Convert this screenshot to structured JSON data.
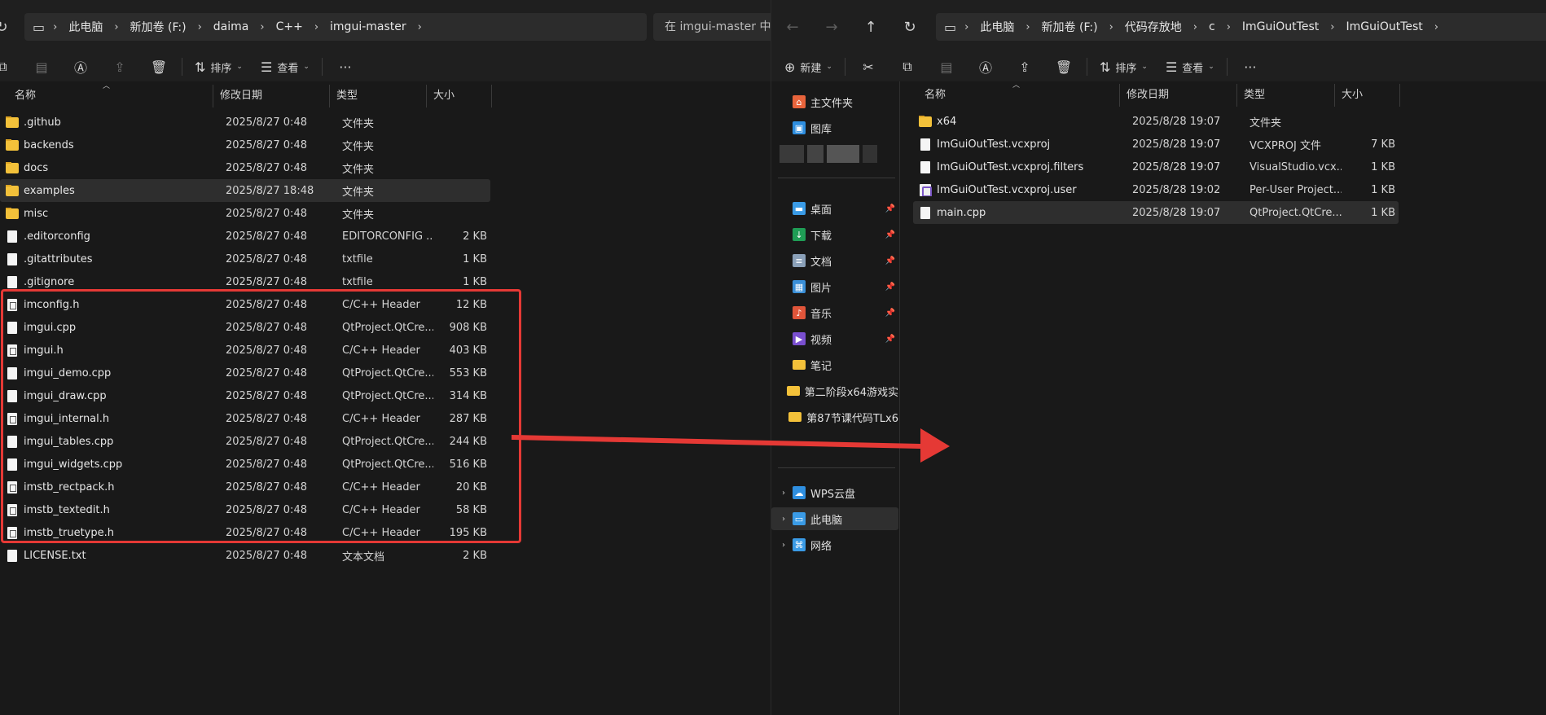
{
  "left": {
    "breadcrumbs": [
      "此电脑",
      "新加卷 (F:)",
      "daima",
      "C++",
      "imgui-master"
    ],
    "search_placeholder": "在 imgui-master 中搜",
    "toolbar": {
      "sort": "排序",
      "view": "查看",
      "more": "···"
    },
    "columns": [
      "名称",
      "修改日期",
      "类型",
      "大小"
    ],
    "files": [
      {
        "name": ".github",
        "date": "2025/8/27 0:48",
        "type": "文件夹",
        "size": "",
        "icon": "folder"
      },
      {
        "name": "backends",
        "date": "2025/8/27 0:48",
        "type": "文件夹",
        "size": "",
        "icon": "folder"
      },
      {
        "name": "docs",
        "date": "2025/8/27 0:48",
        "type": "文件夹",
        "size": "",
        "icon": "folder"
      },
      {
        "name": "examples",
        "date": "2025/8/27 18:48",
        "type": "文件夹",
        "size": "",
        "icon": "folder",
        "selected": true
      },
      {
        "name": "misc",
        "date": "2025/8/27 0:48",
        "type": "文件夹",
        "size": "",
        "icon": "folder"
      },
      {
        "name": ".editorconfig",
        "date": "2025/8/27 0:48",
        "type": "EDITORCONFIG ...",
        "size": "2 KB",
        "icon": "file"
      },
      {
        "name": ".gitattributes",
        "date": "2025/8/27 0:48",
        "type": "txtfile",
        "size": "1 KB",
        "icon": "file"
      },
      {
        "name": ".gitignore",
        "date": "2025/8/27 0:48",
        "type": "txtfile",
        "size": "1 KB",
        "icon": "file"
      },
      {
        "name": "imconfig.h",
        "date": "2025/8/27 0:48",
        "type": "C/C++ Header",
        "size": "12 KB",
        "icon": "code"
      },
      {
        "name": "imgui.cpp",
        "date": "2025/8/27 0:48",
        "type": "QtProject.QtCre...",
        "size": "908 KB",
        "icon": "file"
      },
      {
        "name": "imgui.h",
        "date": "2025/8/27 0:48",
        "type": "C/C++ Header",
        "size": "403 KB",
        "icon": "code"
      },
      {
        "name": "imgui_demo.cpp",
        "date": "2025/8/27 0:48",
        "type": "QtProject.QtCre...",
        "size": "553 KB",
        "icon": "file"
      },
      {
        "name": "imgui_draw.cpp",
        "date": "2025/8/27 0:48",
        "type": "QtProject.QtCre...",
        "size": "314 KB",
        "icon": "file"
      },
      {
        "name": "imgui_internal.h",
        "date": "2025/8/27 0:48",
        "type": "C/C++ Header",
        "size": "287 KB",
        "icon": "code"
      },
      {
        "name": "imgui_tables.cpp",
        "date": "2025/8/27 0:48",
        "type": "QtProject.QtCre...",
        "size": "244 KB",
        "icon": "file"
      },
      {
        "name": "imgui_widgets.cpp",
        "date": "2025/8/27 0:48",
        "type": "QtProject.QtCre...",
        "size": "516 KB",
        "icon": "file"
      },
      {
        "name": "imstb_rectpack.h",
        "date": "2025/8/27 0:48",
        "type": "C/C++ Header",
        "size": "20 KB",
        "icon": "code"
      },
      {
        "name": "imstb_textedit.h",
        "date": "2025/8/27 0:48",
        "type": "C/C++ Header",
        "size": "58 KB",
        "icon": "code"
      },
      {
        "name": "imstb_truetype.h",
        "date": "2025/8/27 0:48",
        "type": "C/C++ Header",
        "size": "195 KB",
        "icon": "code"
      },
      {
        "name": "LICENSE.txt",
        "date": "2025/8/27 0:48",
        "type": "文本文档",
        "size": "2 KB",
        "icon": "file"
      }
    ]
  },
  "right": {
    "breadcrumbs": [
      "此电脑",
      "新加卷 (F:)",
      "代码存放地",
      "c",
      "ImGuiOutTest",
      "ImGuiOutTest"
    ],
    "toolbar": {
      "new": "新建",
      "sort": "排序",
      "view": "查看",
      "more": "···"
    },
    "columns": [
      "名称",
      "修改日期",
      "类型",
      "大小"
    ],
    "nav": [
      {
        "label": "主文件夹",
        "icon": "home-icon",
        "color": "#e8643c",
        "glyph": "⌂"
      },
      {
        "label": "图库",
        "icon": "gallery-icon",
        "color": "#2f8fe0",
        "glyph": "▣"
      },
      {
        "label": "桌面",
        "icon": "desktop-icon",
        "color": "#3a9be6",
        "glyph": "▬",
        "pinned": true
      },
      {
        "label": "下载",
        "icon": "download-icon",
        "color": "#1f9d55",
        "glyph": "↓",
        "pinned": true
      },
      {
        "label": "文档",
        "icon": "documents-icon",
        "color": "#8aa0b8",
        "glyph": "≡",
        "pinned": true
      },
      {
        "label": "图片",
        "icon": "pictures-icon",
        "color": "#3a8fd8",
        "glyph": "▦",
        "pinned": true
      },
      {
        "label": "音乐",
        "icon": "music-icon",
        "color": "#e0553a",
        "glyph": "♪",
        "pinned": true
      },
      {
        "label": "视频",
        "icon": "video-icon",
        "color": "#7a4fd0",
        "glyph": "▶",
        "pinned": true
      },
      {
        "label": "笔记",
        "icon": "folder-icon",
        "color": "#f3c13a",
        "glyph": ""
      },
      {
        "label": "第二阶段x64游戏实",
        "icon": "folder-icon",
        "color": "#f3c13a",
        "glyph": ""
      },
      {
        "label": "第87节课代码TLx6",
        "icon": "folder-icon",
        "color": "#f3c13a",
        "glyph": ""
      }
    ],
    "nav_bottom": [
      {
        "label": "WPS云盘",
        "icon": "cloud-icon",
        "color": "#2f8fe0",
        "glyph": "☁"
      },
      {
        "label": "此电脑",
        "icon": "computer-icon",
        "color": "#3a9be6",
        "glyph": "▭",
        "selected": true
      },
      {
        "label": "网络",
        "icon": "network-icon",
        "color": "#3a9be6",
        "glyph": "⌘"
      }
    ],
    "files": [
      {
        "name": "x64",
        "date": "2025/8/28 19:07",
        "type": "文件夹",
        "size": "",
        "icon": "folder"
      },
      {
        "name": "ImGuiOutTest.vcxproj",
        "date": "2025/8/28 19:07",
        "type": "VCXPROJ 文件",
        "size": "7 KB",
        "icon": "file"
      },
      {
        "name": "ImGuiOutTest.vcxproj.filters",
        "date": "2025/8/28 19:07",
        "type": "VisualStudio.vcx...",
        "size": "1 KB",
        "icon": "file"
      },
      {
        "name": "ImGuiOutTest.vcxproj.user",
        "date": "2025/8/28 19:02",
        "type": "Per-User Project...",
        "size": "1 KB",
        "icon": "vs"
      },
      {
        "name": "main.cpp",
        "date": "2025/8/28 19:07",
        "type": "QtProject.QtCre...",
        "size": "1 KB",
        "icon": "file",
        "selected": true
      }
    ]
  },
  "annotation_color": "#e53935"
}
